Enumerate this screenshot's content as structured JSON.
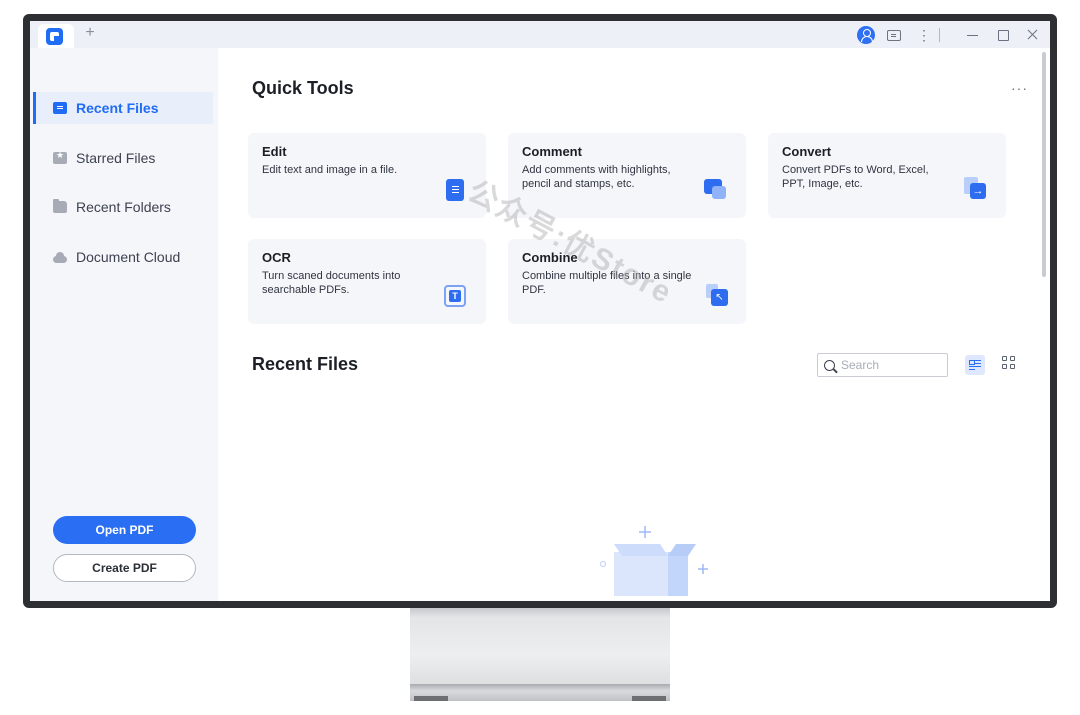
{
  "titlebar": {
    "new_tab_label": "+"
  },
  "sidebar": {
    "items": [
      {
        "label": "Recent Files",
        "icon": "recent-files-icon",
        "active": true
      },
      {
        "label": "Starred Files",
        "icon": "star-icon",
        "active": false
      },
      {
        "label": "Recent Folders",
        "icon": "folder-icon",
        "active": false
      },
      {
        "label": "Document Cloud",
        "icon": "cloud-icon",
        "active": false
      }
    ],
    "open_pdf_label": "Open PDF",
    "create_pdf_label": "Create PDF"
  },
  "main": {
    "quick_tools_title": "Quick Tools",
    "more_label": "···",
    "tools": [
      {
        "title": "Edit",
        "desc": "Edit text and image in a file.",
        "icon": "edit-tool-icon"
      },
      {
        "title": "Comment",
        "desc": "Add comments with highlights, pencil and stamps, etc.",
        "icon": "comment-tool-icon"
      },
      {
        "title": "Convert",
        "desc": "Convert PDFs to Word, Excel, PPT, Image, etc.",
        "icon": "convert-tool-icon"
      },
      {
        "title": "OCR",
        "desc": "Turn scaned documents into searchable PDFs.",
        "icon": "ocr-tool-icon"
      },
      {
        "title": "Combine",
        "desc": "Combine multiple files into a single PDF.",
        "icon": "combine-tool-icon"
      }
    ],
    "recent_files_title": "Recent Files",
    "search": {
      "placeholder": "Search",
      "value": ""
    }
  },
  "watermark": "公众号:优Store",
  "colors": {
    "accent": "#1f6cf5",
    "sidebar_bg": "#f5f6fa",
    "card_bg": "#f5f6fa",
    "monitor_frame": "#2d2f33"
  }
}
